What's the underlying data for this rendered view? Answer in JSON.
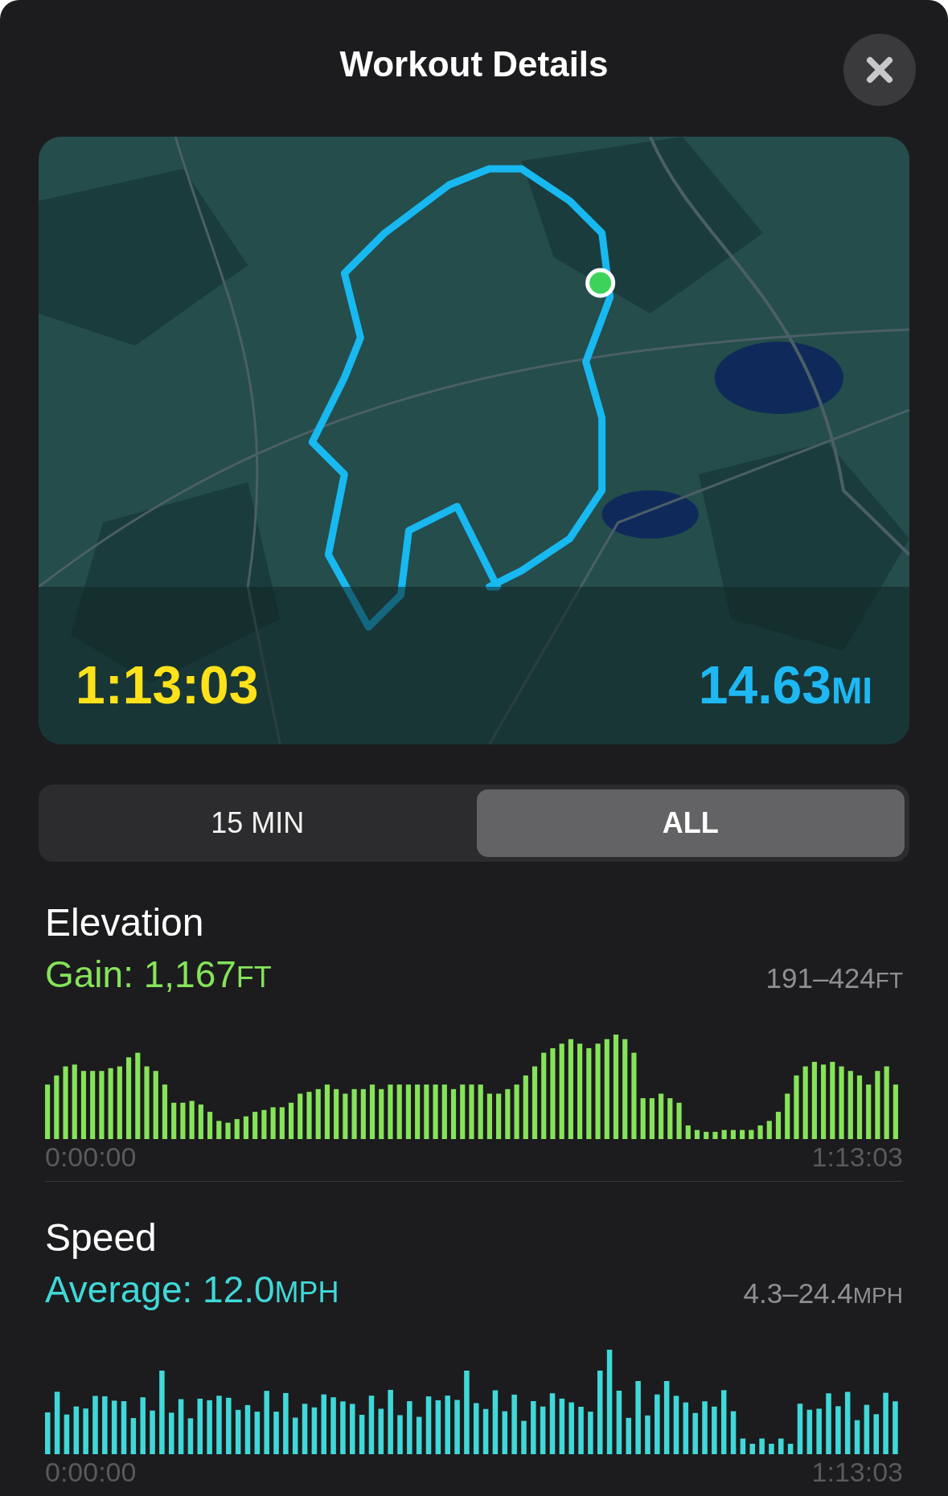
{
  "header": {
    "title": "Workout Details"
  },
  "map": {
    "kind": "picture",
    "duration": "1:13:03",
    "distance": "14.63",
    "distance_unit": "MI"
  },
  "segments": [
    {
      "label": "15 MIN",
      "selected": false
    },
    {
      "label": "ALL",
      "selected": true
    }
  ],
  "metrics": [
    {
      "title": "Elevation",
      "summary": "Gain: 1,167",
      "summary_unit": "FT",
      "range": "191–424",
      "range_unit": "FT",
      "start": "0:00:00",
      "end": "1:13:03",
      "color": "#86e35a"
    },
    {
      "title": "Speed",
      "summary": "Average: 12.0",
      "summary_unit": "MPH",
      "range": "4.3–24.4",
      "range_unit": "MPH",
      "start": "0:00:00",
      "end": "1:13:03",
      "color": "#40d8d8"
    }
  ]
}
